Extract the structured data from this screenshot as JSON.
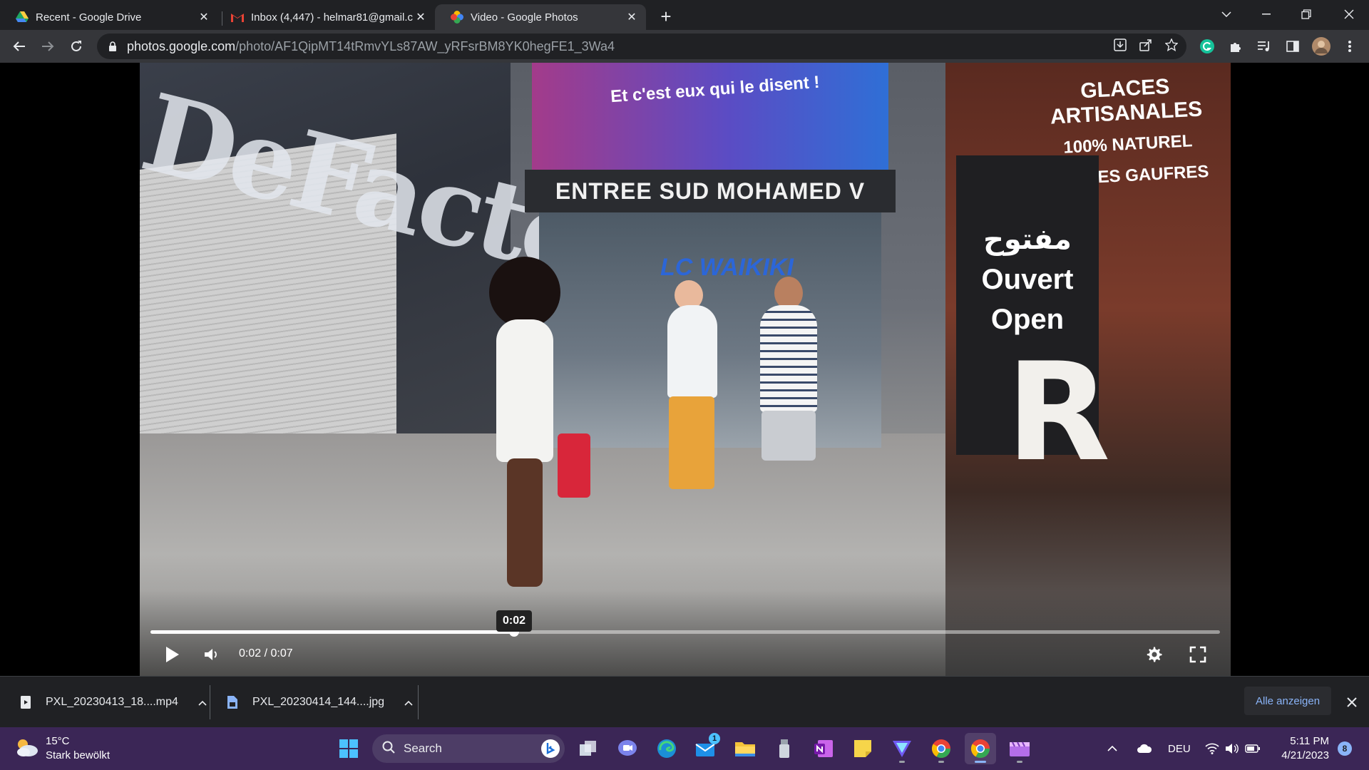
{
  "browser": {
    "tabs": [
      {
        "title": "Recent - Google Drive",
        "icon": "google-drive-icon"
      },
      {
        "title": "Inbox (4,447) - helmar81@gmail.c",
        "icon": "gmail-icon"
      },
      {
        "title": "Video - Google Photos",
        "icon": "google-photos-icon",
        "active": true
      }
    ],
    "url_host": "photos.google.com",
    "url_path": "/photo/AF1QipMT14tRmvYLs87AW_yRFsrBM8YK0hegFE1_3Wa4"
  },
  "video": {
    "scene_text": {
      "brand": "DeFacto",
      "banner": "Et c'est eux qui le disent !",
      "entrance": "ENTREE SUD MOHAMED V",
      "store": "LC WAIKIKI",
      "stall_top": "GLACES ARTISANALES",
      "stall_mid": "100% NATUREL",
      "stall_low": "CRÊPES GAUFRES",
      "sign_arabic": "مفتوح",
      "sign_fr": "Ouvert",
      "sign_en": "Open",
      "letter": "R"
    },
    "tooltip_time": "0:02",
    "time_display": "0:02 / 0:07",
    "progress_fraction": 0.34
  },
  "downloads": {
    "items": [
      {
        "name": "PXL_20230413_18....mp4",
        "icon": "video-file-icon"
      },
      {
        "name": "PXL_20230414_144....jpg",
        "icon": "image-file-icon"
      }
    ],
    "show_all": "Alle anzeigen"
  },
  "taskbar": {
    "weather_temp": "15°C",
    "weather_desc": "Stark bewölkt",
    "search_label": "Search",
    "language": "DEU",
    "time": "5:11 PM",
    "date": "4/21/2023",
    "notifications": "8",
    "mail_badge": "1"
  },
  "colors": {
    "tabstrip": "#202124",
    "toolbar": "#35363a",
    "taskbar": "#3b2656",
    "accent": "#8ab4f8"
  }
}
